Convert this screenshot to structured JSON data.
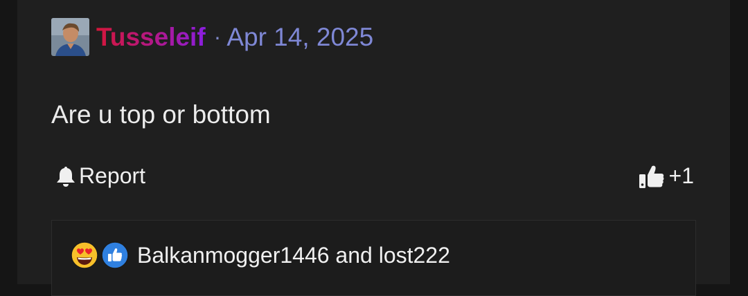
{
  "post": {
    "author": "Tusseleif",
    "separator": "·",
    "date": "Apr 14, 2025",
    "content": "Are u top or bottom"
  },
  "actions": {
    "report_label": "Report",
    "like_count": "+1"
  },
  "reactions": {
    "icons": [
      "heart-eyes-emoji-icon",
      "thumbs-up-reaction-icon"
    ],
    "summary": "Balkanmogger1446 and lost222"
  },
  "colors": {
    "background": "#1f1f1f",
    "username_gradient": [
      "#d5163a",
      "#8a1ee0"
    ],
    "date": "#7f88d6",
    "like_blue": "#2f80e0"
  }
}
